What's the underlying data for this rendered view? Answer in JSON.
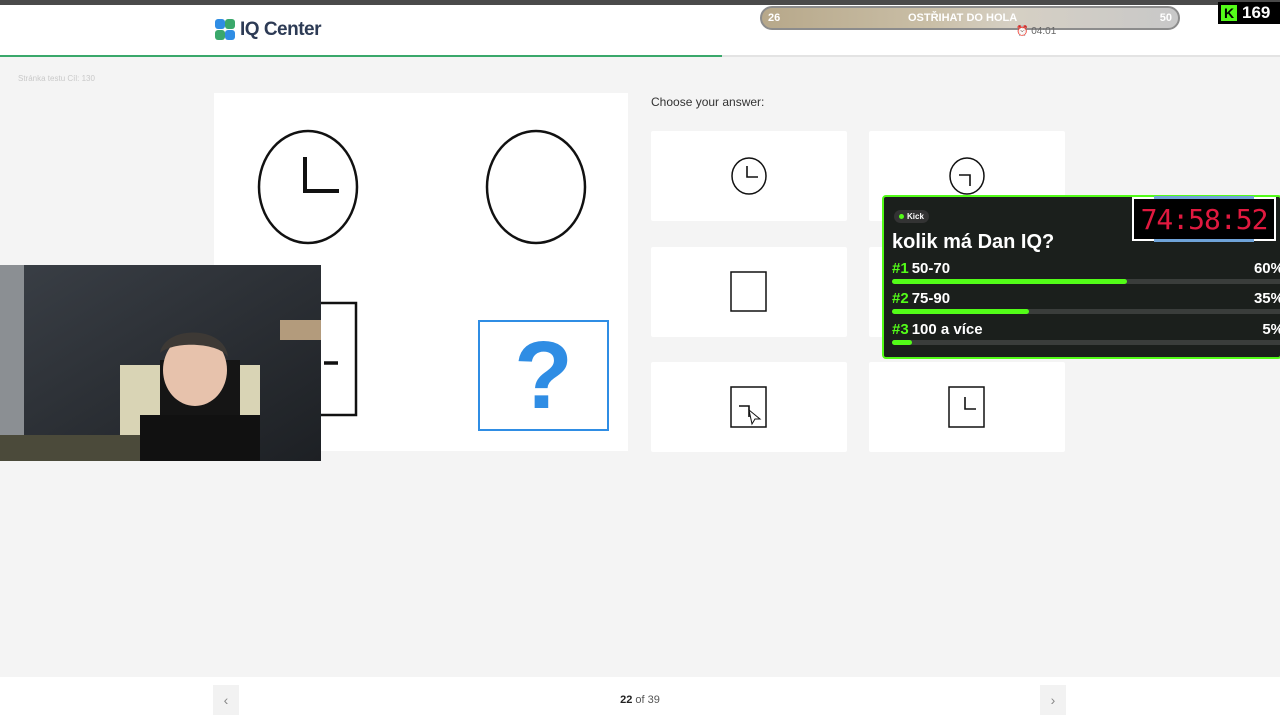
{
  "app": {
    "logo_text": "IQ Center"
  },
  "progress": {
    "fraction": 0.564
  },
  "breadcrumb": "Stránka testu   Cíl: 130",
  "puzzle": {
    "question_mark": "?",
    "cells": [
      "clock-with-hands",
      "empty-circle",
      "rectangle-with-line",
      "missing"
    ]
  },
  "answers": {
    "label": "Choose your answer:",
    "options": [
      {
        "id": 1,
        "shape": "clock-circle"
      },
      {
        "id": 2,
        "shape": "circle-with-inverted-hand"
      },
      {
        "id": 3,
        "shape": "empty-square"
      },
      {
        "id": 4,
        "shape": "hidden"
      },
      {
        "id": 5,
        "shape": "rectangle-with-inverted-hand"
      },
      {
        "id": 6,
        "shape": "rectangle-with-hand"
      }
    ]
  },
  "pagination": {
    "current": "22",
    "of_text": "of",
    "total": "39",
    "prev_icon": "chevron-left-icon",
    "next_icon": "chevron-right-icon"
  },
  "overlay": {
    "goal": {
      "left": "26",
      "title": "OSTŘIHAT DO HOLA",
      "right": "50",
      "timer": "04:01"
    },
    "kick": {
      "count": "169"
    },
    "poll": {
      "tag": "Kick",
      "question": "kolik má Dan IQ?",
      "rows": [
        {
          "num": "#1",
          "label": "50-70",
          "pct": "60%",
          "value": 60
        },
        {
          "num": "#2",
          "label": "75-90",
          "pct": "35%",
          "value": 35
        },
        {
          "num": "#3",
          "label": "100 a více",
          "pct": "5%",
          "value": 5
        }
      ]
    },
    "timer": "74:58:52"
  },
  "colors": {
    "accent": "#2f8de4",
    "kick_green": "#53fc18",
    "timer_red": "#e0193f"
  }
}
